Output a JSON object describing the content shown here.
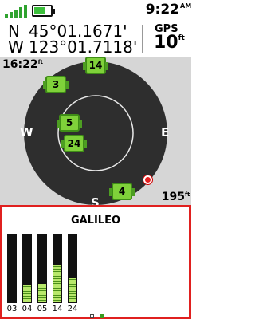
{
  "status_bar": {
    "clock_time": "9:22",
    "clock_ampm": "AM"
  },
  "coordinates": {
    "lat_hemisphere": "N",
    "lat_value": "45°01.1671'",
    "lon_hemisphere": "W",
    "lon_value": "123°01.7118'"
  },
  "gps": {
    "label": "GPS",
    "accuracy_value": "10",
    "accuracy_unit": "ft"
  },
  "sky_view": {
    "time_value": "16:22",
    "time_unit": "ft",
    "elevation_value": "195",
    "elevation_unit": "ft",
    "compass": {
      "west": "W",
      "east": "E",
      "south": "S"
    },
    "satellites": [
      {
        "id": "14"
      },
      {
        "id": "3"
      },
      {
        "id": "5"
      },
      {
        "id": "24"
      },
      {
        "id": "4"
      }
    ]
  },
  "galileo": {
    "title": "GALILEO",
    "bars": [
      {
        "label": "03",
        "level": 0
      },
      {
        "label": "04",
        "level": 0.26
      },
      {
        "label": "05",
        "level": 0.27
      },
      {
        "label": "14",
        "level": 0.55
      },
      {
        "label": "24",
        "level": 0.37
      }
    ]
  },
  "colors": {
    "satellite_fill": "#7fd13a",
    "panel_border": "#e0201f",
    "position_marker": "#e62020",
    "sky_disc": "#2e2e2e"
  }
}
